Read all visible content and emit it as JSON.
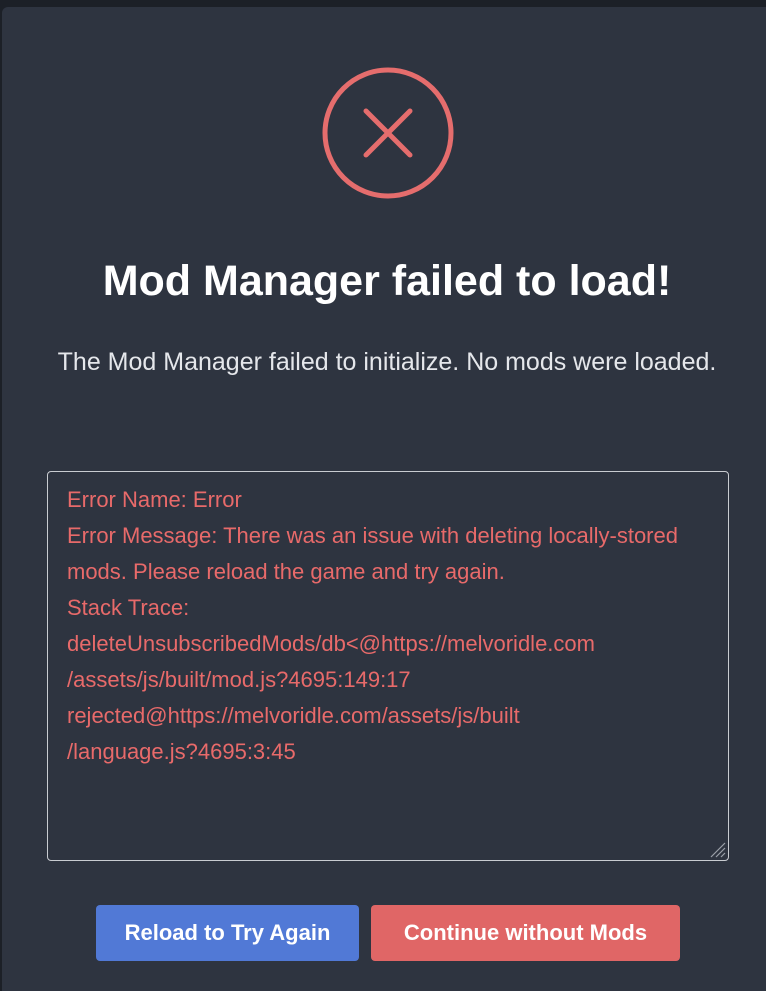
{
  "dialog": {
    "title": "Mod Manager failed to load!",
    "message": "The Mod Manager failed to initialize. No mods were loaded.",
    "icon": "error-x-circle-icon",
    "error_details": {
      "error_name": "Error Name: Error",
      "error_message": "Error Message: There was an issue with deleting locally-stored mods. Please reload the game and try again.",
      "stack_trace_label": "Stack Trace:",
      "stack_line_1a": "deleteUnsubscribedMods/db<@https://melvoridle.com",
      "stack_line_1b": "/assets/js/built/mod.js?4695:149:17",
      "stack_line_2a": "rejected@https://melvoridle.com/assets/js/built",
      "stack_line_2b": "/language.js?4695:3:45"
    },
    "buttons": {
      "reload": "Reload to Try Again",
      "continue": "Continue without Mods"
    }
  },
  "colors": {
    "background": "#2e3440",
    "error": "#e86a6a",
    "reload_button": "#5179d6",
    "continue_button": "#e06666"
  }
}
